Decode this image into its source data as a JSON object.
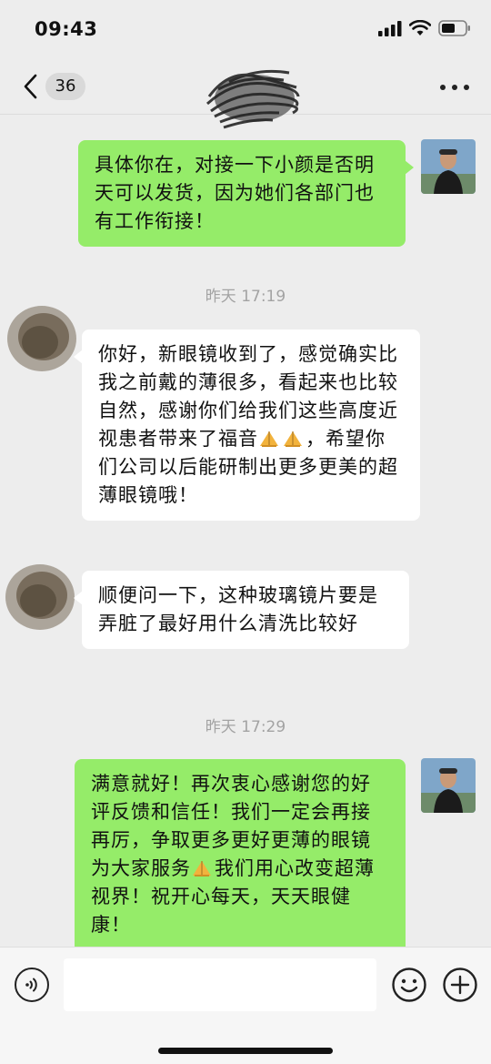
{
  "status_bar": {
    "time": "09:43"
  },
  "nav": {
    "unread_count": "36"
  },
  "messages": [
    {
      "direction": "outgoing",
      "text": "具体你在，对接一下小颜是否明天可以发货，因为她们各部门也有工作衔接！"
    },
    {
      "type": "timestamp",
      "text": "昨天 17:19"
    },
    {
      "direction": "incoming",
      "text_before_emoji": "你好，新眼镜收到了，感觉确实比我之前戴的薄很多，看起来也比较自然，感谢你们给我们这些高度近视患者带来了福音",
      "emoji": [
        "folded-hands",
        "folded-hands"
      ],
      "text_after_emoji": "，希望你们公司以后能研制出更多更美的超薄眼镜哦！"
    },
    {
      "direction": "incoming",
      "text": "顺便问一下，这种玻璃镜片要是弄脏了最好用什么清洗比较好"
    },
    {
      "type": "timestamp",
      "text": "昨天 17:29"
    },
    {
      "direction": "outgoing",
      "text_before_emoji": "满意就好！再次衷心感谢您的好评反馈和信任！我们一定会再接再厉，争取更多更好更薄的眼镜为大家服务",
      "emoji": [
        "folded-hands"
      ],
      "text_after_emoji": "我们用心改变超薄视界！祝开心每天，天天眼健康！"
    }
  ],
  "input_bar": {
    "value": "",
    "icons": [
      "voice-icon",
      "emoji-icon",
      "plus-icon"
    ]
  },
  "colors": {
    "background": "#ededed",
    "outgoing_bubble": "#95ec69",
    "incoming_bubble": "#ffffff",
    "timestamp_text": "#a3a3a3"
  }
}
